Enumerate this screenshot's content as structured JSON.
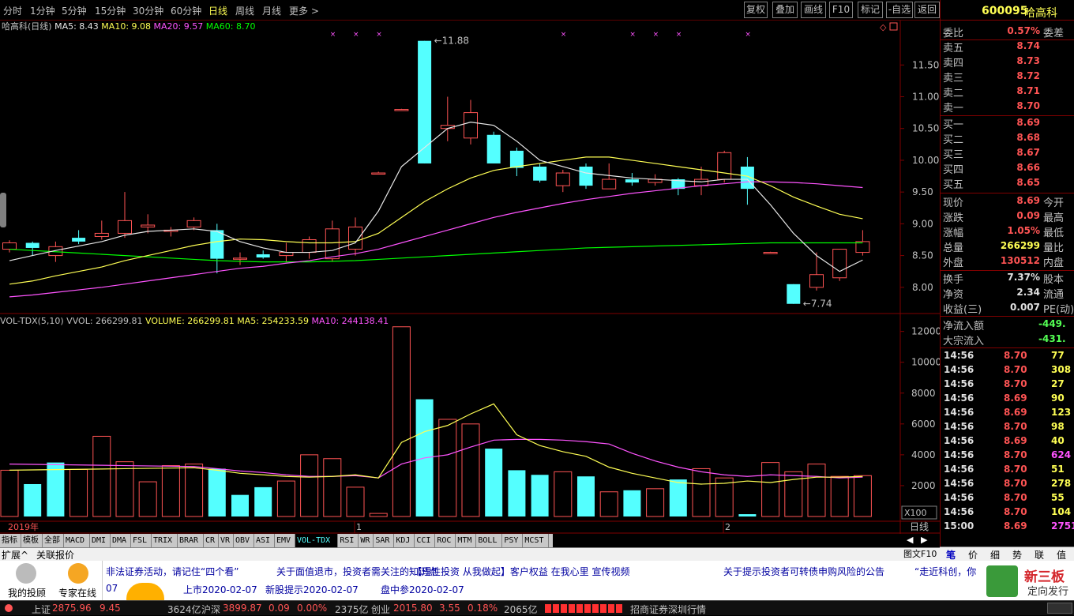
{
  "period_tabs": [
    "分时",
    "1分钟",
    "5分钟",
    "15分钟",
    "30分钟",
    "60分钟",
    "日线",
    "周线",
    "月线",
    "更多 >"
  ],
  "active_period": "日线",
  "tools": [
    "复权",
    "叠加",
    "画线",
    "F10",
    "标记",
    "-自选",
    "返回"
  ],
  "stock": {
    "code": "600095",
    "name": "哈高科"
  },
  "price_legend": {
    "title": "哈高科(日线)",
    "ma5": "MA5: 8.43",
    "ma10": "MA10: 9.08",
    "ma20": "MA20: 9.57",
    "ma60": "MA60: 8.70"
  },
  "vol_legend": {
    "title": "VOL-TDX(5,10)",
    "vvol": "VVOL: 266299.81",
    "volume": "VOLUME: 266299.81",
    "ma5": "MA5: 254233.59",
    "ma10": "MA10: 244138.41"
  },
  "annotations": {
    "high": "11.88",
    "low": "7.74",
    "year": "2019年",
    "m1": "1",
    "m2": "2",
    "x100": "X100",
    "period_label": "日线"
  },
  "colors": {
    "up": "#ff5454",
    "down": "#54ffff",
    "ma5": "#e8e8e8",
    "ma10": "#ffff54",
    "ma20": "#ff54ff",
    "ma60": "#00ff00",
    "grid": "#800000"
  },
  "chart_data": [
    {
      "type": "candlestick",
      "title": "哈高科(日线)",
      "ylim": [
        7.6,
        12.1
      ],
      "ticks": [
        "8.00",
        "8.50",
        "9.00",
        "9.50",
        "10.00",
        "10.50",
        "11.00",
        "11.50"
      ],
      "ohlc": [
        [
          8.6,
          8.74,
          8.55,
          8.7
        ],
        [
          8.7,
          8.72,
          8.5,
          8.62
        ],
        [
          8.5,
          8.72,
          8.4,
          8.64
        ],
        [
          8.78,
          8.9,
          8.68,
          8.72
        ],
        [
          8.8,
          9.05,
          8.75,
          8.85
        ],
        [
          8.85,
          9.5,
          8.78,
          9.05
        ],
        [
          8.95,
          9.15,
          8.85,
          8.98
        ],
        [
          8.88,
          8.95,
          8.8,
          8.9
        ],
        [
          8.95,
          9.1,
          8.9,
          9.05
        ],
        [
          8.9,
          9.0,
          8.22,
          8.45
        ],
        [
          8.45,
          8.55,
          8.35,
          8.46
        ],
        [
          8.52,
          8.58,
          8.45,
          8.47
        ],
        [
          8.5,
          8.7,
          8.4,
          8.55
        ],
        [
          8.55,
          8.8,
          8.45,
          8.75
        ],
        [
          8.45,
          9.05,
          8.4,
          8.92
        ],
        [
          8.6,
          9.1,
          8.5,
          8.95
        ],
        [
          9.8,
          9.82,
          9.78,
          9.8
        ],
        [
          10.8,
          10.81,
          10.79,
          10.8
        ],
        [
          11.88,
          11.88,
          9.95,
          9.95
        ],
        [
          10.5,
          11.0,
          10.3,
          10.55
        ],
        [
          10.35,
          10.95,
          10.25,
          10.75
        ],
        [
          10.4,
          10.45,
          9.95,
          9.95
        ],
        [
          10.15,
          10.2,
          9.75,
          9.88
        ],
        [
          9.9,
          9.95,
          9.65,
          9.68
        ],
        [
          9.6,
          9.85,
          9.5,
          9.8
        ],
        [
          9.9,
          9.95,
          9.55,
          9.6
        ],
        [
          9.55,
          9.95,
          9.55,
          9.7
        ],
        [
          9.7,
          9.8,
          9.6,
          9.65
        ],
        [
          9.65,
          9.78,
          9.6,
          9.7
        ],
        [
          9.7,
          9.72,
          9.45,
          9.55
        ],
        [
          9.6,
          9.9,
          9.45,
          9.7
        ],
        [
          9.7,
          10.15,
          9.65,
          10.12
        ],
        [
          9.9,
          10.05,
          9.3,
          9.55
        ],
        [
          8.55,
          8.56,
          8.54,
          8.55
        ],
        [
          8.05,
          8.05,
          7.74,
          7.74
        ],
        [
          8.0,
          8.55,
          7.95,
          8.2
        ],
        [
          8.15,
          8.6,
          8.1,
          8.6
        ],
        [
          8.55,
          8.9,
          8.5,
          8.72
        ]
      ],
      "ma5": [
        8.42,
        8.5,
        8.58,
        8.65,
        8.72,
        8.82,
        8.88,
        8.9,
        8.92,
        8.88,
        8.72,
        8.62,
        8.55,
        8.55,
        8.58,
        8.7,
        9.2,
        9.9,
        10.2,
        10.5,
        10.6,
        10.55,
        10.3,
        10.0,
        9.9,
        9.8,
        9.76,
        9.72,
        9.7,
        9.68,
        9.66,
        9.7,
        9.7,
        9.3,
        8.85,
        8.5,
        8.25,
        8.43
      ],
      "ma10": [
        8.05,
        8.1,
        8.18,
        8.25,
        8.32,
        8.42,
        8.5,
        8.58,
        8.66,
        8.72,
        8.76,
        8.75,
        8.72,
        8.7,
        8.7,
        8.72,
        8.85,
        9.1,
        9.35,
        9.55,
        9.72,
        9.84,
        9.9,
        9.95,
        10.0,
        10.05,
        10.05,
        10.0,
        9.95,
        9.9,
        9.85,
        9.8,
        9.75,
        9.6,
        9.42,
        9.28,
        9.15,
        9.08
      ],
      "ma20": [
        7.85,
        7.88,
        7.92,
        7.96,
        8.0,
        8.05,
        8.1,
        8.15,
        8.2,
        8.25,
        8.3,
        8.33,
        8.38,
        8.42,
        8.48,
        8.53,
        8.6,
        8.7,
        8.8,
        8.9,
        9.0,
        9.1,
        9.18,
        9.25,
        9.32,
        9.38,
        9.43,
        9.48,
        9.52,
        9.56,
        9.6,
        9.63,
        9.66,
        9.66,
        9.65,
        9.63,
        9.6,
        9.57
      ],
      "ma60": [
        8.6,
        8.58,
        8.56,
        8.54,
        8.52,
        8.5,
        8.48,
        8.46,
        8.44,
        8.42,
        8.41,
        8.4,
        8.4,
        8.4,
        8.41,
        8.42,
        8.44,
        8.46,
        8.48,
        8.5,
        8.52,
        8.54,
        8.56,
        8.58,
        8.6,
        8.62,
        8.63,
        8.64,
        8.65,
        8.66,
        8.67,
        8.68,
        8.69,
        8.7,
        8.7,
        8.7,
        8.7,
        8.7
      ]
    },
    {
      "type": "bar",
      "title": "VOL-TDX(5,10)",
      "ylim": [
        0,
        12800
      ],
      "ticks": [
        "2000",
        "4000",
        "6000",
        "8000",
        "10000",
        "12000"
      ],
      "values": [
        3000,
        2100,
        3500,
        3050,
        5200,
        3550,
        2250,
        3300,
        3400,
        3100,
        1400,
        1900,
        2300,
        4000,
        3750,
        1900,
        200,
        12300,
        7600,
        6300,
        6000,
        4400,
        3000,
        2700,
        2900,
        2600,
        1600,
        1700,
        1800,
        2400,
        3100,
        2500,
        150,
        3500,
        2900,
        3400,
        2600,
        2650
      ],
      "up": [
        1,
        0,
        0,
        1,
        1,
        1,
        1,
        1,
        1,
        0,
        0,
        0,
        1,
        1,
        1,
        1,
        1,
        1,
        0,
        1,
        1,
        0,
        0,
        0,
        1,
        0,
        1,
        0,
        1,
        0,
        1,
        1,
        0,
        1,
        1,
        1,
        1,
        1
      ],
      "ma5": [
        3000,
        3020,
        3040,
        3060,
        3080,
        3100,
        3120,
        3140,
        3160,
        3000,
        2800,
        2700,
        2600,
        2550,
        2600,
        2700,
        2500,
        4800,
        5500,
        5900,
        6650,
        7300,
        5300,
        4600,
        4200,
        3900,
        3200,
        2800,
        2500,
        2200,
        2100,
        2150,
        2300,
        2200,
        2400,
        2550,
        2550,
        2600
      ],
      "ma10": [
        3400,
        3380,
        3360,
        3340,
        3320,
        3300,
        3280,
        3260,
        3240,
        3100,
        2950,
        2850,
        2700,
        2600,
        2600,
        2650,
        2500,
        3400,
        3800,
        4000,
        4500,
        4950,
        5000,
        5000,
        4950,
        4850,
        4700,
        4100,
        3600,
        3200,
        2900,
        2700,
        2600,
        2700,
        2650,
        2600,
        2500,
        2550
      ]
    }
  ],
  "depth": {
    "labels": [
      "委比",
      "卖五",
      "卖四",
      "卖三",
      "卖二",
      "卖一",
      "买一",
      "买二",
      "买三",
      "买四",
      "买五"
    ],
    "values": [
      "0.57%",
      "8.74",
      "8.73",
      "8.72",
      "8.71",
      "8.70",
      "8.69",
      "8.68",
      "8.67",
      "8.66",
      "8.65"
    ],
    "weicha_label": "委差"
  },
  "quote": [
    [
      "现价",
      "8.69",
      "今开"
    ],
    [
      "涨跌",
      "0.09",
      "最高"
    ],
    [
      "涨幅",
      "1.05%",
      "最低"
    ],
    [
      "总量",
      "266299",
      "量比"
    ],
    [
      "外盘",
      "130512",
      "内盘"
    ],
    [
      "换手",
      "7.37%",
      "股本"
    ],
    [
      "净资",
      "2.34",
      "流通"
    ],
    [
      "收益(三)",
      "0.007",
      "PE(动)"
    ]
  ],
  "flow": [
    [
      "净流入额",
      "-449."
    ],
    [
      "大宗流入",
      "-431."
    ]
  ],
  "ticks_list": [
    [
      "14:56",
      "8.70",
      "77"
    ],
    [
      "14:56",
      "8.70",
      "308"
    ],
    [
      "14:56",
      "8.70",
      "27"
    ],
    [
      "14:56",
      "8.69",
      "90"
    ],
    [
      "14:56",
      "8.69",
      "123"
    ],
    [
      "14:56",
      "8.70",
      "98"
    ],
    [
      "14:56",
      "8.69",
      "40"
    ],
    [
      "14:56",
      "8.70",
      "624"
    ],
    [
      "14:56",
      "8.70",
      "51"
    ],
    [
      "14:56",
      "8.70",
      "278"
    ],
    [
      "14:56",
      "8.70",
      "55"
    ],
    [
      "14:56",
      "8.70",
      "104"
    ],
    [
      "15:00",
      "8.69",
      "2751"
    ]
  ],
  "indicators": [
    "指标",
    "模板",
    "全部",
    "MACD",
    "DMI",
    "DMA",
    "FSL",
    "TRIX",
    "BRAR",
    "CR",
    "VR",
    "OBV",
    "ASI",
    "EMV",
    "VOL-TDX",
    "RSI",
    "WR",
    "SAR",
    "KDJ",
    "CCI",
    "ROC",
    "MTM",
    "BOLL",
    "PSY",
    "MCST"
  ],
  "ext_tabs": [
    "扩展^",
    "关联报价"
  ],
  "right_tabs": [
    "笔",
    "价",
    "细",
    "势",
    "联",
    "值"
  ],
  "figure_label": "图文F10",
  "news": {
    "my_invest": "我的投顾",
    "expert": "专家在线",
    "line1": [
      "非法证券活动，请记住“四个看”",
      "关于面值退市，投资者需关注的知识点",
      "【理性投资 从我做起】客户权益 在我心里 宣传视频",
      "关于提示投资者可转债申购风险的公告",
      "“走近科创，你"
    ],
    "line2": [
      "07",
      "上市2020-02-07",
      "新股提示2020-02-07",
      "盘中参2020-02-07"
    ],
    "brand": "新三板",
    "brand_sub": "定向发行"
  },
  "status": {
    "sh_label": "上证",
    "sh_val": "2875.96",
    "sh_chg": "9.45",
    "sh_amt": "3624亿",
    "hs_label": "沪深",
    "hs_val": "3899.87",
    "hs_chg": "0.09",
    "hs_pct": "0.00%",
    "hs_amt": "2375亿",
    "cy_label": "创业",
    "cy_val": "2015.80",
    "cy_chg": "3.55",
    "cy_pct": "0.18%",
    "cy_amt": "2065亿",
    "broker": "招商证券深圳行情"
  }
}
